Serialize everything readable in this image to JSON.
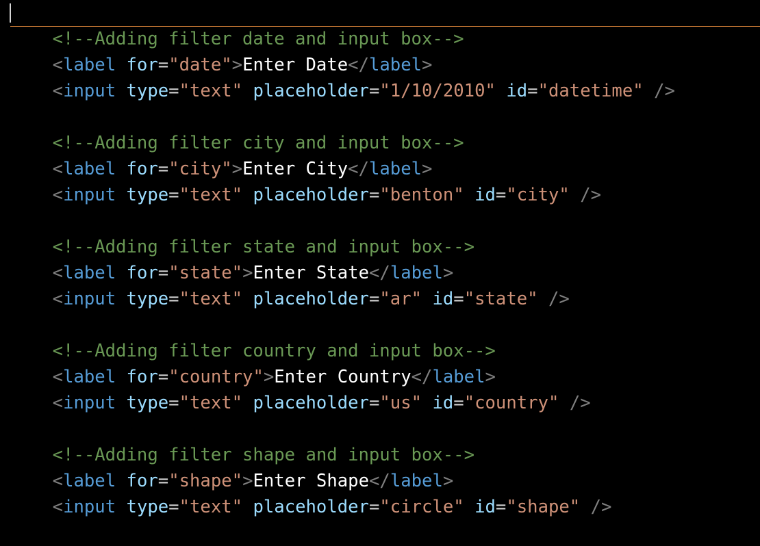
{
  "editor": {
    "blocks": [
      {
        "comment": "<!--Adding filter date and input box-->",
        "label_for_value": "\"date\"",
        "label_text": "Enter Date",
        "input_placeholder_value": "\"1/10/2010\"",
        "input_id_value": "\"datetime\""
      },
      {
        "comment": "<!--Adding filter city and input box-->",
        "label_for_value": "\"city\"",
        "label_text": "Enter City",
        "input_placeholder_value": "\"benton\"",
        "input_id_value": "\"city\""
      },
      {
        "comment": "<!--Adding filter state and input box-->",
        "label_for_value": "\"state\"",
        "label_text": "Enter State",
        "input_placeholder_value": "\"ar\"",
        "input_id_value": "\"state\""
      },
      {
        "comment": "<!--Adding filter country and input box-->",
        "label_for_value": "\"country\"",
        "label_text": "Enter Country",
        "input_placeholder_value": "\"us\"",
        "input_id_value": "\"country\""
      },
      {
        "comment": "<!--Adding filter shape and input box-->",
        "label_for_value": "\"shape\"",
        "label_text": "Enter Shape",
        "input_placeholder_value": "\"circle\"",
        "input_id_value": "\"shape\""
      }
    ],
    "syntax": {
      "open": "<",
      "close": ">",
      "open_close": "</",
      "self_close": "/>",
      "equals": "=",
      "space": " ",
      "label_tag": "label",
      "input_tag": "input",
      "for_attr": "for",
      "type_attr": "type",
      "type_value": "\"text\"",
      "placeholder_attr": "placeholder",
      "id_attr": "id"
    },
    "colors": {
      "background": "#000000",
      "comment": "#6a9955",
      "punctuation": "#808080",
      "tag": "#569cd6",
      "attribute": "#9cdcfe",
      "string": "#ce9178",
      "text": "#ffffff",
      "current_line_border": "#e58a3c"
    }
  }
}
